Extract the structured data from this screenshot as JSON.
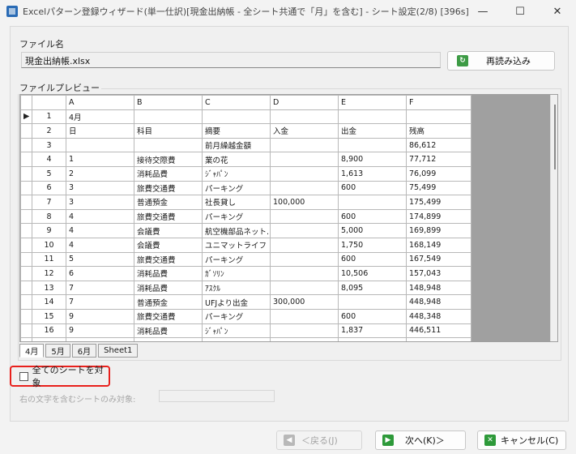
{
  "window": {
    "title": "Excelパターン登録ウィザード(単一仕訳)[現金出納帳 - 全シート共通で「月」を含む] - シート設定(2/8) [396s]",
    "minimize": "—",
    "maximize": "☐",
    "close": "✕"
  },
  "file": {
    "group_label": "ファイル名",
    "name": "現金出納帳.xlsx",
    "reload_label": "再読み込み"
  },
  "preview": {
    "group_label": "ファイルプレビュー",
    "columns": [
      "A",
      "B",
      "C",
      "D",
      "E",
      "F"
    ],
    "rows": [
      {
        "num": "1",
        "cells": [
          "4月",
          "",
          "",
          "",
          "",
          ""
        ]
      },
      {
        "num": "2",
        "cells": [
          "日",
          "科目",
          "摘要",
          "入金",
          "出金",
          "残高"
        ]
      },
      {
        "num": "3",
        "cells": [
          "",
          "",
          "前月繰越金額",
          "",
          "",
          "86,612"
        ]
      },
      {
        "num": "4",
        "cells": [
          "1",
          "接待交際費",
          "業の花",
          "",
          "8,900",
          "77,712"
        ]
      },
      {
        "num": "5",
        "cells": [
          "2",
          "消耗品費",
          "ｼﾞｬﾊﾟﾝ",
          "",
          "1,613",
          "76,099"
        ]
      },
      {
        "num": "6",
        "cells": [
          "3",
          "旅費交通費",
          "パーキング",
          "",
          "600",
          "75,499"
        ]
      },
      {
        "num": "7",
        "cells": [
          "3",
          "普通預金",
          "社長貸し",
          "100,000",
          "",
          "175,499"
        ]
      },
      {
        "num": "8",
        "cells": [
          "4",
          "旅費交通費",
          "パーキング",
          "",
          "600",
          "174,899"
        ]
      },
      {
        "num": "9",
        "cells": [
          "4",
          "会議費",
          "航空機部品ネット...",
          "",
          "5,000",
          "169,899"
        ]
      },
      {
        "num": "10",
        "cells": [
          "4",
          "会議費",
          "ユニマットライフ",
          "",
          "1,750",
          "168,149"
        ]
      },
      {
        "num": "11",
        "cells": [
          "5",
          "旅費交通費",
          "パーキング",
          "",
          "600",
          "167,549"
        ]
      },
      {
        "num": "12",
        "cells": [
          "6",
          "消耗品費",
          "ｶﾞｿﾘﾝ",
          "",
          "10,506",
          "157,043"
        ]
      },
      {
        "num": "13",
        "cells": [
          "7",
          "消耗品費",
          "ｱｽｸﾙ",
          "",
          "8,095",
          "148,948"
        ]
      },
      {
        "num": "14",
        "cells": [
          "7",
          "普通預金",
          "UFJより出金",
          "300,000",
          "",
          "448,948"
        ]
      },
      {
        "num": "15",
        "cells": [
          "9",
          "旅費交通費",
          "パーキング",
          "",
          "600",
          "448,348"
        ]
      },
      {
        "num": "16",
        "cells": [
          "9",
          "消耗品費",
          "ｼﾞｬﾊﾟﾝ",
          "",
          "1,837",
          "446,511"
        ]
      }
    ],
    "current_row_marker": "▶"
  },
  "sheets": [
    "4月",
    "5月",
    "6月",
    "Sheet1"
  ],
  "options": {
    "all_sheets_label": "全てのシートを対象",
    "filter_label": "右の文字を含むシートのみ対象:",
    "filter_value": ""
  },
  "footer": {
    "back_label": "＜戻る(J)",
    "next_label": "次へ(K)＞",
    "cancel_label": "キャンセル(C)"
  },
  "colors": {
    "highlight_border": "#e8201c",
    "next_icon": "#2e9a3a",
    "cancel_icon": "#2e9a3a"
  }
}
